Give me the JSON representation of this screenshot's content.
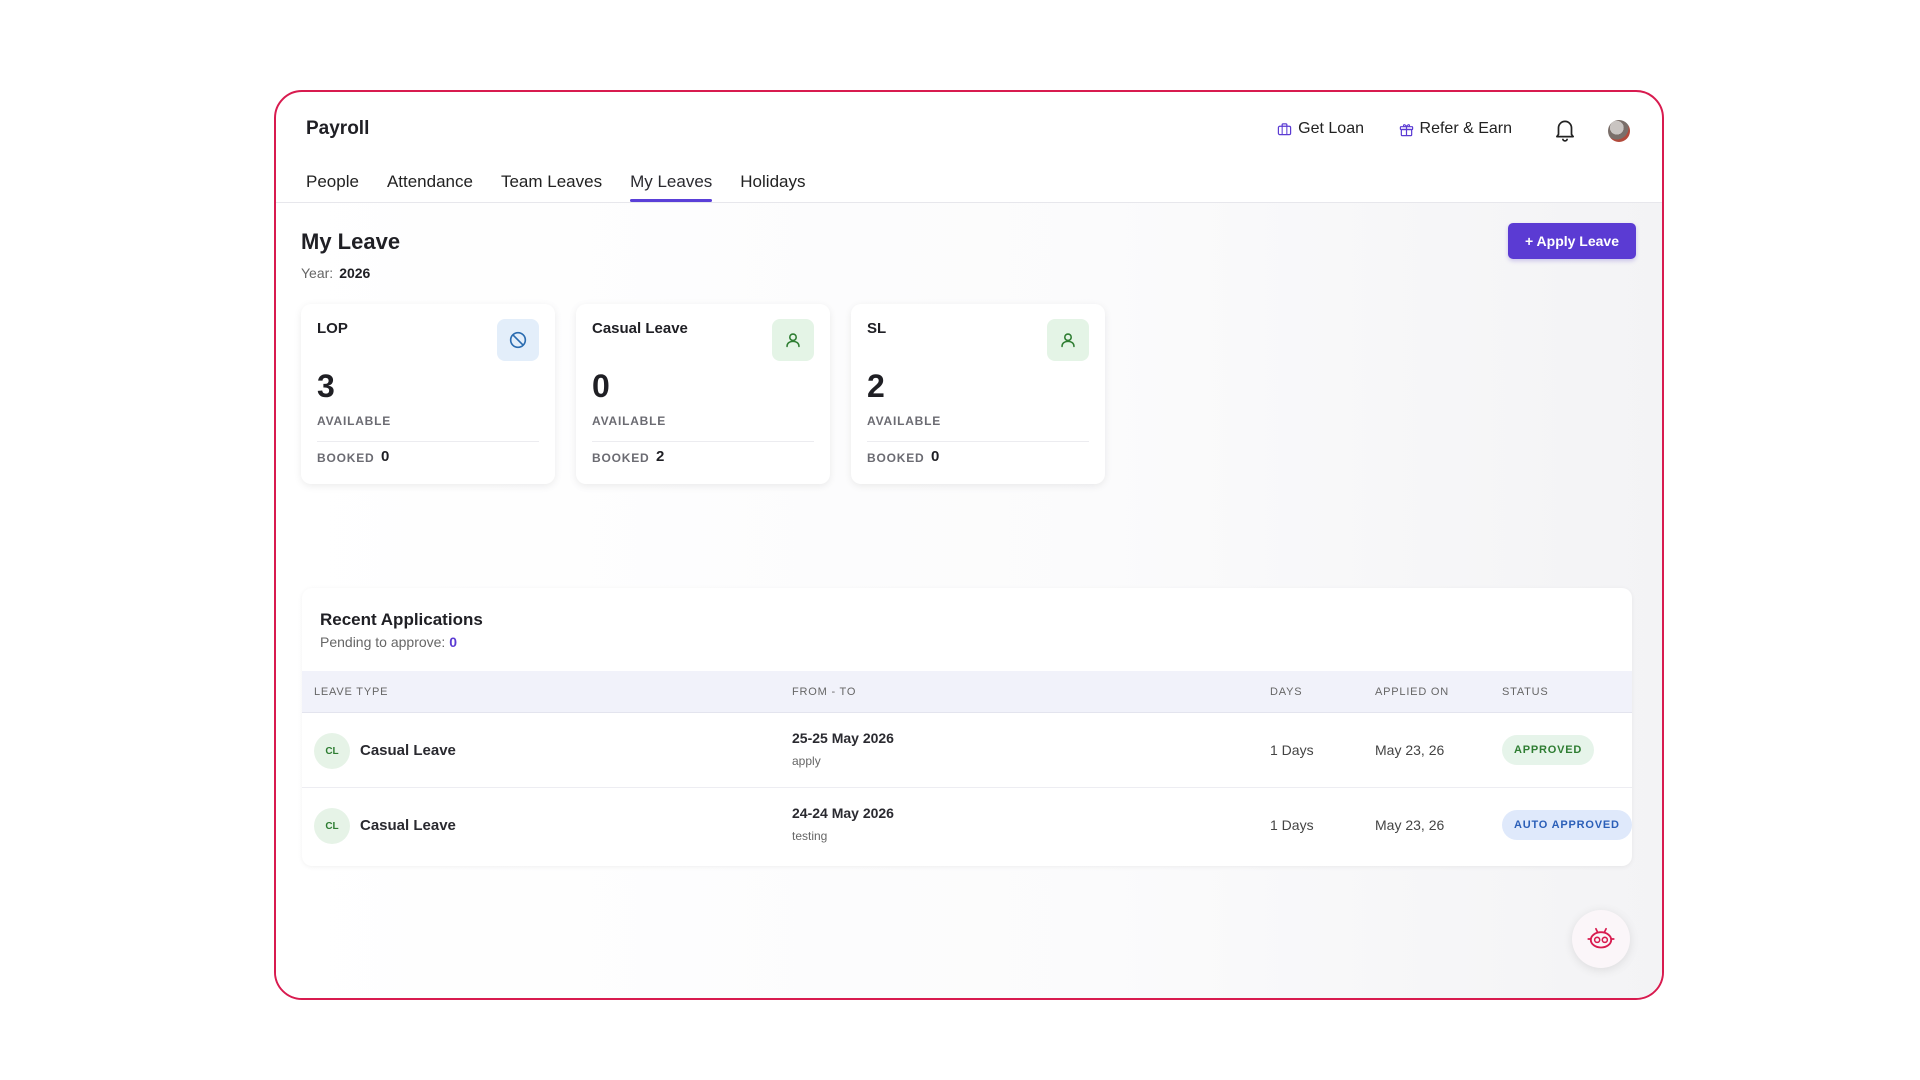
{
  "app": {
    "title": "Payroll"
  },
  "header": {
    "get_loan": "Get Loan",
    "refer_earn": "Refer & Earn"
  },
  "tabs": [
    {
      "label": "People",
      "active": false
    },
    {
      "label": "Attendance",
      "active": false
    },
    {
      "label": "Team Leaves",
      "active": false
    },
    {
      "label": "My Leaves",
      "active": true
    },
    {
      "label": "Holidays",
      "active": false
    }
  ],
  "page": {
    "title": "My Leave",
    "year_label": "Year:",
    "year_value": "2026",
    "apply_button": "+ Apply Leave"
  },
  "cards": [
    {
      "title": "LOP",
      "icon": "block-icon",
      "icon_color": "#2b6cb0",
      "available": "3",
      "available_label": "AVAILABLE",
      "booked_label": "BOOKED",
      "booked": "0"
    },
    {
      "title": "Casual Leave",
      "icon": "person-icon",
      "icon_color": "#2e7d32",
      "available": "0",
      "available_label": "AVAILABLE",
      "booked_label": "BOOKED",
      "booked": "2"
    },
    {
      "title": "SL",
      "icon": "person-icon",
      "icon_color": "#2e7d32",
      "available": "2",
      "available_label": "AVAILABLE",
      "booked_label": "BOOKED",
      "booked": "0"
    }
  ],
  "recent": {
    "title": "Recent Applications",
    "pending_label": "Pending to approve:",
    "pending_value": "0",
    "columns": [
      "LEAVE TYPE",
      "FROM - TO",
      "DAYS",
      "APPLIED ON",
      "STATUS"
    ],
    "rows": [
      {
        "badge": "CL",
        "type": "Casual Leave",
        "range": "25-25 May 2026",
        "reason": "apply",
        "days": "1 Days",
        "applied_on": "May 23, 26",
        "status": "APPROVED"
      },
      {
        "badge": "CL",
        "type": "Casual Leave",
        "range": "24-24 May 2026",
        "reason": "testing",
        "days": "1 Days",
        "applied_on": "May 23, 26",
        "status": "AUTO APPROVED"
      }
    ]
  },
  "colors": {
    "frame_border": "#d81b4f",
    "accent": "#5b3bd3",
    "approved": "#2e7d32",
    "auto_approved": "#2b5fb8"
  }
}
